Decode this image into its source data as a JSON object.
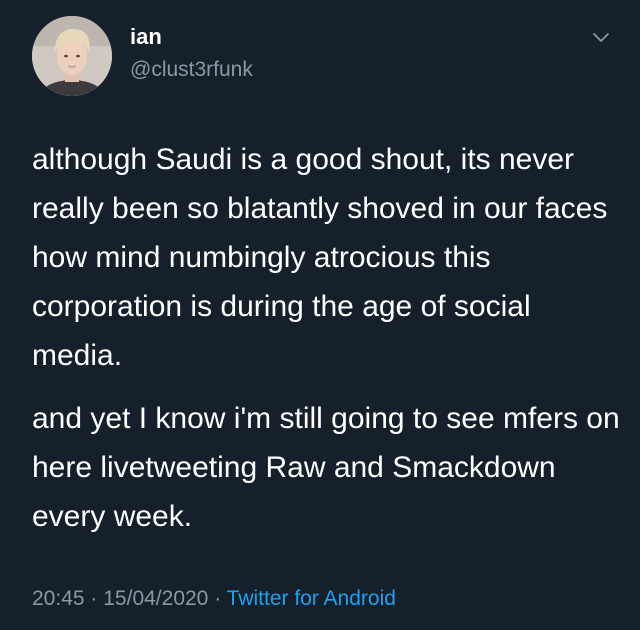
{
  "author": {
    "display_name": "ian",
    "handle": "@clust3rfunk",
    "avatar_icon": "profile-photo"
  },
  "tweet": {
    "paragraphs": [
      "although Saudi is a good shout, its never really been so blatantly shoved in our faces how mind numbingly atrocious this corporation is during the age of social media.",
      "and yet I know i'm still going to see mfers on here livetweeting Raw and Smackdown every week."
    ],
    "time": "20:45",
    "separator": "·",
    "date": "15/04/2020",
    "source": "Twitter for Android"
  },
  "colors": {
    "background": "#15202b",
    "primary_text": "#ffffff",
    "secondary_text": "#8899a6",
    "accent": "#1da1f2"
  },
  "icons": {
    "menu": "chevron-down-icon"
  }
}
